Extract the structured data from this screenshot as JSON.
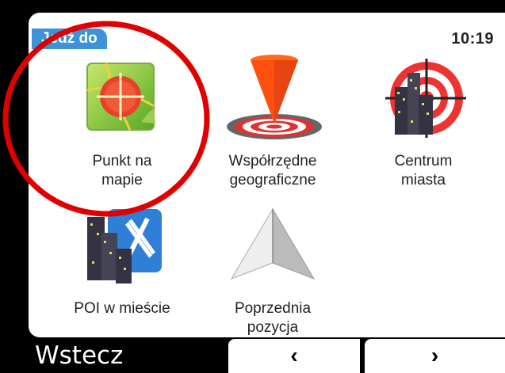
{
  "header": {
    "title": "Jedź do",
    "time": "10:19"
  },
  "menu": {
    "items": [
      {
        "label": "Punkt na\nmapie",
        "icon": "map-point-icon"
      },
      {
        "label": "Współrzędne\ngeograficzne",
        "icon": "coordinates-target-icon"
      },
      {
        "label": "Centrum\nmiasta",
        "icon": "city-center-icon"
      },
      {
        "label": "POI w mieście",
        "icon": "city-poi-icon"
      },
      {
        "label": "Poprzednia\npozycja",
        "icon": "previous-position-icon"
      }
    ]
  },
  "footer": {
    "back_label": "Wstecz",
    "prev_label": "‹",
    "next_label": "›"
  },
  "colors": {
    "accent": "#3d92d8",
    "highlight_circle": "#e00000"
  }
}
